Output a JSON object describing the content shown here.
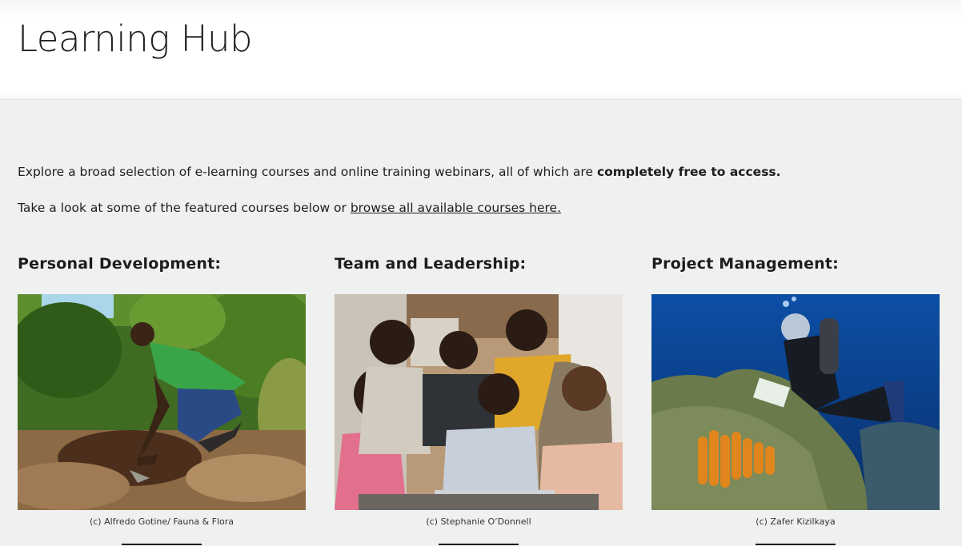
{
  "header": {
    "title": "Learning Hub"
  },
  "intro": {
    "text_before": "Explore a broad selection of e-learning courses and online training webinars, all of which are ",
    "text_bold": "completely free to access."
  },
  "intro2": {
    "text_before": "Take a look at some of the featured courses below or ",
    "link": "browse all available courses here."
  },
  "courses": [
    {
      "title": "Personal Development:",
      "credit": "(c) Alfredo Gotine/ Fauna & Flora"
    },
    {
      "title": "Team and Leadership:",
      "credit": "(c) Stephanie O’Donnell"
    },
    {
      "title": "Project Management:",
      "credit": "(c) Zafer Kizilkaya"
    }
  ]
}
